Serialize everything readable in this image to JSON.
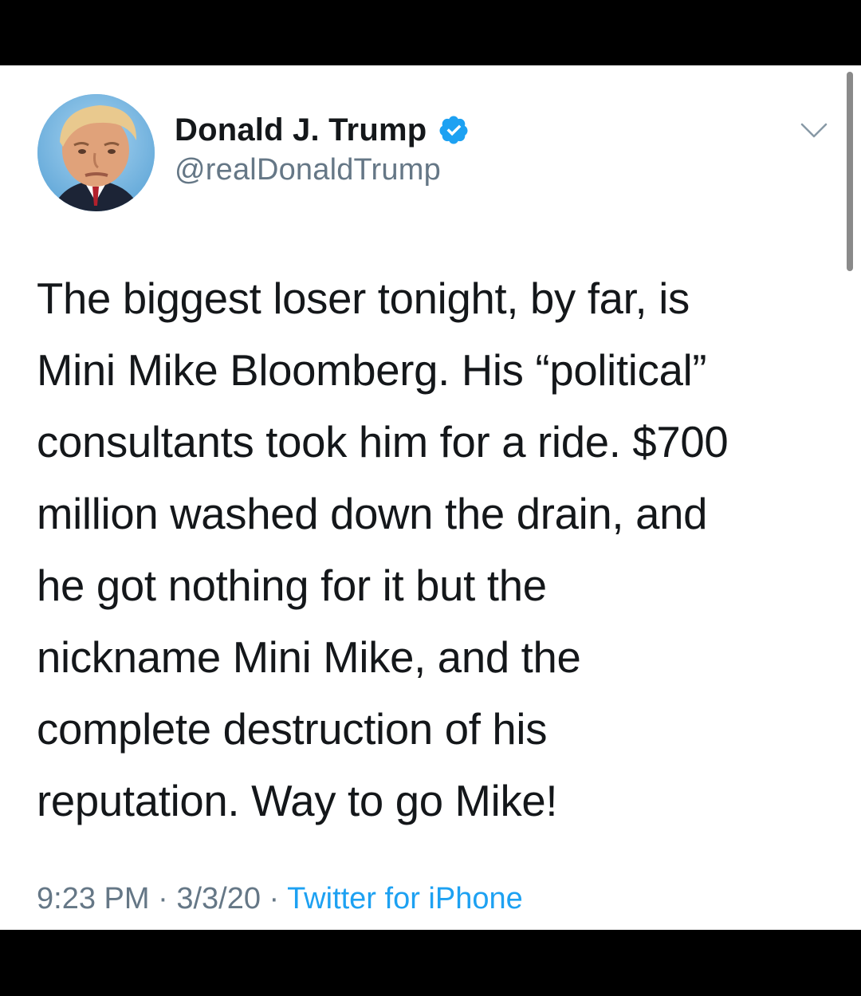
{
  "tweet": {
    "author": {
      "display_name": "Donald J. Trump",
      "handle": "@realDonaldTrump",
      "verified": true
    },
    "text_lines": [
      "The biggest loser tonight, by far, is",
      "Mini Mike Bloomberg. His “political”",
      "consultants took him for a ride. $700",
      "million washed down the drain, and",
      "he got nothing for it but the",
      "nickname Mini Mike, and the",
      "complete destruction of his",
      "reputation. Way to go Mike!"
    ],
    "time": "9:23 PM",
    "separator": "·",
    "date": "3/3/20",
    "source": "Twitter for iPhone"
  },
  "icons": {
    "verified": "verified-badge-icon",
    "caret": "chevron-down-icon"
  },
  "colors": {
    "text": "#14171a",
    "secondary": "#657786",
    "accent": "#1da1f2"
  }
}
